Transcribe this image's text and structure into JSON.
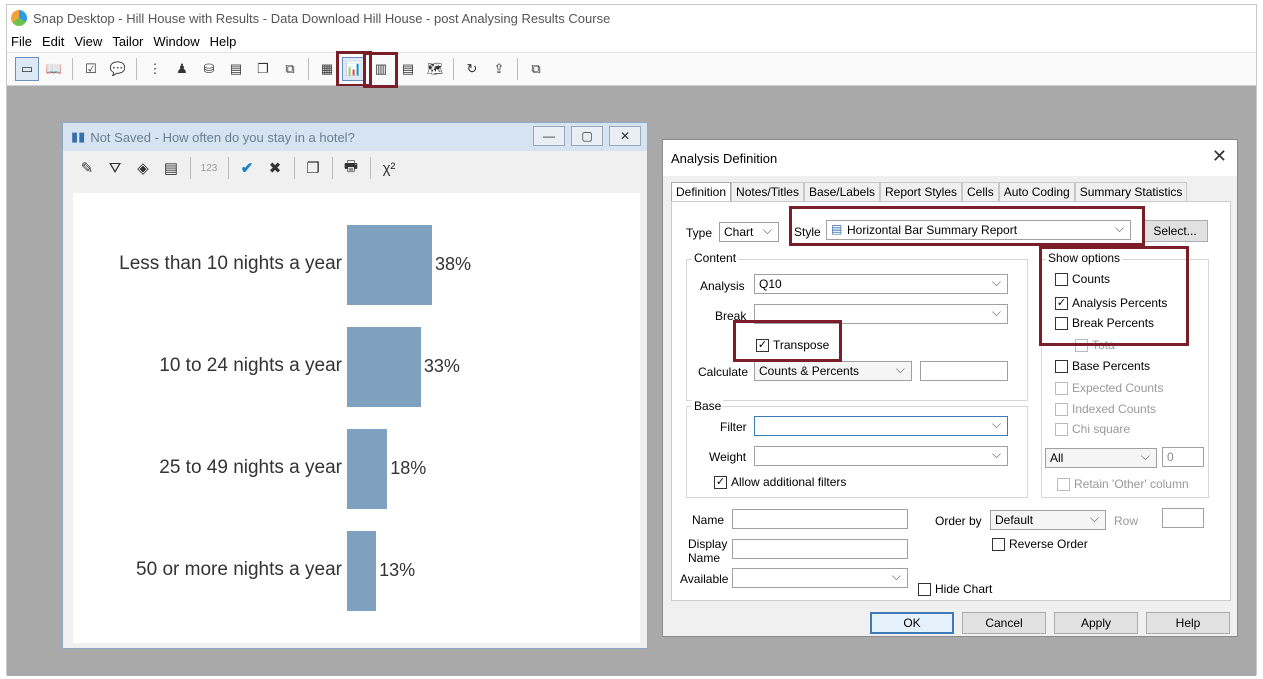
{
  "app": {
    "title": "Snap Desktop - Hill House with Results - Data Download Hill House - post Analysing Results Course"
  },
  "menu": [
    "File",
    "Edit",
    "View",
    "Tailor",
    "Window",
    "Help"
  ],
  "chart_window": {
    "title": "Not Saved - How often do you stay in a hotel?",
    "buttons": {
      "minimize": "—",
      "maximize": "▢",
      "close": "✕"
    }
  },
  "chart_data": {
    "type": "bar",
    "orientation": "horizontal",
    "categories": [
      "Less than 10 nights a year",
      "10 to 24 nights a year",
      "25 to 49 nights a year",
      "50 or more nights a year"
    ],
    "values": [
      38,
      33,
      18,
      13
    ],
    "value_labels": [
      "38%",
      "33%",
      "18%",
      "13%"
    ],
    "bar_color": "#7ea1bf",
    "grid": false,
    "legend": "none"
  },
  "dialog": {
    "title": "Analysis Definition",
    "tabs": [
      "Definition",
      "Notes/Titles",
      "Base/Labels",
      "Report Styles",
      "Cells",
      "Auto Coding",
      "Summary Statistics"
    ],
    "type_label": "Type",
    "type_value": "Chart",
    "style_label": "Style",
    "style_value": "Horizontal Bar Summary Report",
    "select_button": "Select...",
    "content_group": "Content",
    "analysis_label": "Analysis",
    "analysis_value": "Q10",
    "break_label": "Break",
    "break_value": "",
    "transpose_label": "Transpose",
    "calculate_label": "Calculate",
    "calculate_value": "Counts & Percents",
    "base_group": "Base",
    "filter_label": "Filter",
    "filter_value": "",
    "weight_label": "Weight",
    "weight_value": "",
    "allow_filters_label": "Allow additional filters",
    "show_options_group": "Show options",
    "show_options": {
      "counts": "Counts",
      "analysis_percents": "Analysis Percents",
      "break_percents": "Break Percents",
      "hidden_option": "Tota",
      "base_percents": "Base Percents",
      "expected_counts": "Expected Counts",
      "indexed_counts": "Indexed Counts",
      "chi_square": "Chi square"
    },
    "all_value": "All",
    "spin_value": "0",
    "retain_other": "Retain 'Other' column",
    "name_label": "Name",
    "display_name_label_1": "Display",
    "display_name_label_2": "Name",
    "available_label": "Available",
    "order_by_label": "Order by",
    "order_by_value": "Default",
    "row_label": "Row",
    "reverse_order_label": "Reverse Order",
    "hide_chart_label": "Hide Chart",
    "buttons": {
      "ok": "OK",
      "cancel": "Cancel",
      "apply": "Apply",
      "help": "Help"
    },
    "close": "✕"
  },
  "colors": {
    "highlight": "#7a1f2a",
    "bar": "#7ea1bf",
    "workspace": "#a9a9a9"
  }
}
